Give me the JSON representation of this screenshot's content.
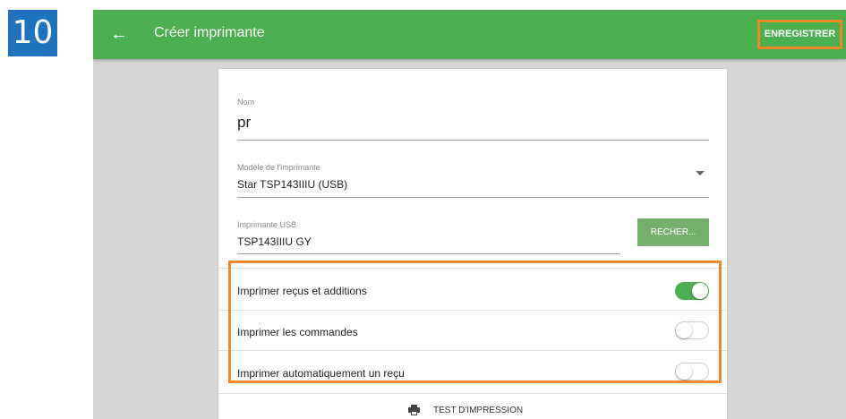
{
  "step_number": "10",
  "appbar": {
    "back_icon": "arrow-left-icon",
    "title": "Créer imprimante",
    "save_label": "ENREGISTRER"
  },
  "form": {
    "name": {
      "label": "Nom",
      "value": "pr"
    },
    "model": {
      "label": "Modèle de l'imprimante",
      "value": "Star TSP143IIIU (USB)"
    },
    "usb_printer": {
      "label": "Imprimante USB",
      "value": "TSP143IIIU GY",
      "search_label": "RECHER..."
    }
  },
  "toggles": [
    {
      "label": "Imprimer reçus et additions",
      "on": true
    },
    {
      "label": "Imprimer les commandes",
      "on": false
    },
    {
      "label": "Imprimer automatiquement un reçu",
      "on": false
    }
  ],
  "print_test": {
    "label": "TEST D'IMPRESSION",
    "icon": "printer-icon"
  },
  "colors": {
    "accent": "#4caf50",
    "highlight": "#f0892c",
    "badge": "#1e73be"
  }
}
